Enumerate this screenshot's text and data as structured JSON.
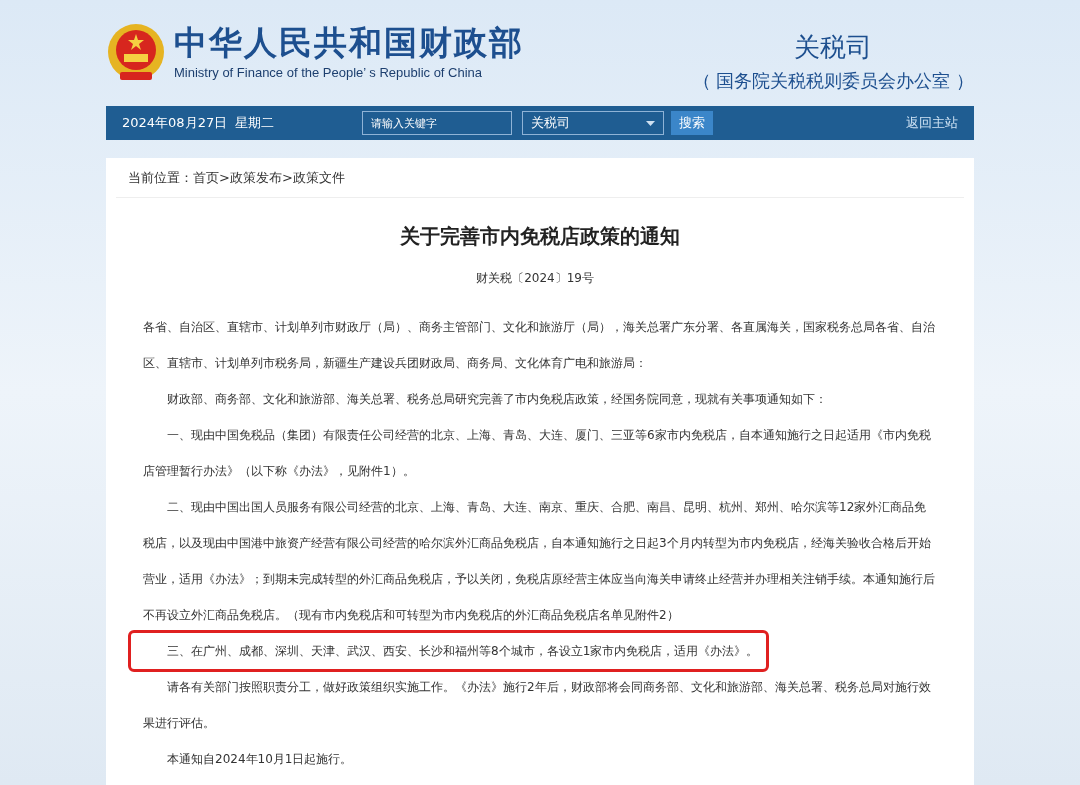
{
  "header": {
    "site_name": "中华人民共和国财政部",
    "site_name_en": "Ministry of Finance of the People’ s Republic of China",
    "department": "关税司",
    "department_sub": "（ 国务院关税税则委员会办公室 ）"
  },
  "nav": {
    "date": "2024年08月27日  星期二",
    "search": {
      "placeholder": "请输入关键字"
    },
    "scope_select": "关税司",
    "search_button": "搜索",
    "home_link": "返回主站"
  },
  "breadcrumb": {
    "label": "当前位置：",
    "items": [
      "首页",
      ">",
      "政策发布",
      ">",
      "政策文件"
    ]
  },
  "article": {
    "title": "关于完善市内免税店政策的通知",
    "doc_number": "财关税〔2024〕19号",
    "paragraphs": [
      {
        "text": "各省、自治区、直辖市、计划单列市财政厅（局）、商务主管部门、文化和旅游厅（局），海关总署广东分署、各直属海关，国家税务总局各省、自治区、直辖市、计划单列市税务局，新疆生产建设兵团财政局、商务局、文化体育广电和旅游局：",
        "indented": false,
        "highlighted": false
      },
      {
        "text": "财政部、商务部、文化和旅游部、海关总署、税务总局研究完善了市内免税店政策，经国务院同意，现就有关事项通知如下：",
        "indented": true,
        "highlighted": false
      },
      {
        "text": "一、现由中国免税品（集团）有限责任公司经营的北京、上海、青岛、大连、厦门、三亚等6家市内免税店，自本通知施行之日起适用《市内免税店管理暂行办法》（以下称《办法》，见附件1）。",
        "indented": true,
        "highlighted": false
      },
      {
        "text": "二、现由中国出国人员服务有限公司经营的北京、上海、青岛、大连、南京、重庆、合肥、南昌、昆明、杭州、郑州、哈尔滨等12家外汇商品免税店，以及现由中国港中旅资产经营有限公司经营的哈尔滨外汇商品免税店，自本通知施行之日起3个月内转型为市内免税店，经海关验收合格后开始营业，适用《办法》；到期未完成转型的外汇商品免税店，予以关闭，免税店原经营主体应当向海关申请终止经营并办理相关注销手续。本通知施行后不再设立外汇商品免税店。（现有市内免税店和可转型为市内免税店的外汇商品免税店名单见附件2）",
        "indented": true,
        "highlighted": false
      },
      {
        "text": "三、在广州、成都、深圳、天津、武汉、西安、长沙和福州等8个城市，各设立1家市内免税店，适用《办法》。",
        "indented": true,
        "highlighted": true
      },
      {
        "text": "请各有关部门按照职责分工，做好政策组织实施工作。《办法》施行2年后，财政部将会同商务部、文化和旅游部、海关总署、税务总局对施行效果进行评估。",
        "indented": true,
        "highlighted": false
      },
      {
        "text": "本通知自2024年10月1日起施行。",
        "indented": true,
        "highlighted": false
      }
    ]
  }
}
